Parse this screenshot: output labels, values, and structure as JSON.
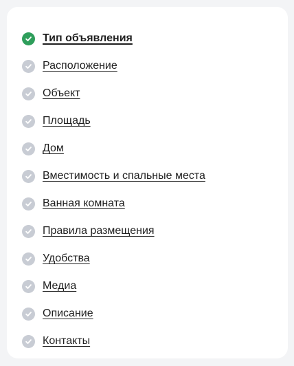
{
  "steps": [
    {
      "label": "Тип объявления",
      "status": "current",
      "icon": "check-circle-icon"
    },
    {
      "label": "Расположение",
      "status": "done",
      "icon": "check-circle-icon"
    },
    {
      "label": "Объект",
      "status": "done",
      "icon": "check-circle-icon"
    },
    {
      "label": "Площадь",
      "status": "done",
      "icon": "check-circle-icon"
    },
    {
      "label": "Дом",
      "status": "done",
      "icon": "check-circle-icon"
    },
    {
      "label": "Вместимость и спальные места",
      "status": "done",
      "icon": "check-circle-icon"
    },
    {
      "label": "Ванная комната",
      "status": "done",
      "icon": "check-circle-icon"
    },
    {
      "label": "Правила размещения",
      "status": "done",
      "icon": "check-circle-icon"
    },
    {
      "label": "Удобства",
      "status": "done",
      "icon": "check-circle-icon"
    },
    {
      "label": "Медиа",
      "status": "done",
      "icon": "check-circle-icon"
    },
    {
      "label": "Описание",
      "status": "done",
      "icon": "check-circle-icon"
    },
    {
      "label": "Контакты",
      "status": "done",
      "icon": "check-circle-icon"
    }
  ],
  "colors": {
    "background": "#f3f4f6",
    "card": "#ffffff",
    "text": "#1f1f1f",
    "check_current": "#2e9e5b",
    "check_done": "#c8ccd4"
  }
}
